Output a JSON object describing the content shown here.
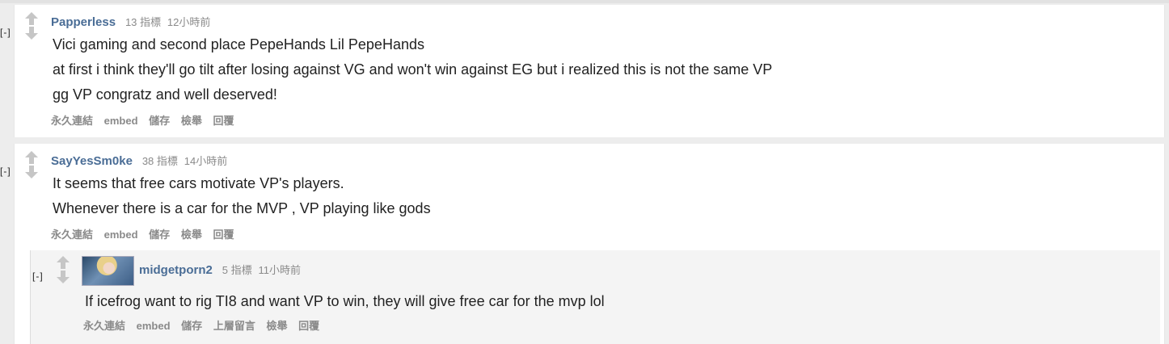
{
  "colors": {
    "author": "#4a6d96",
    "meta": "#8a8a8a",
    "text": "#222222"
  },
  "icons": {
    "upvote": "up-arrow",
    "downvote": "down-arrow"
  },
  "comments": [
    {
      "collapse": "[-]",
      "author": "Papperless",
      "score": "13 指標",
      "time": "12小時前",
      "lines": [
        "Vici gaming and second place PepeHands Lil PepeHands",
        "at first i think they'll go tilt after losing against VG and won't win against EG but i realized this is not the same VP",
        "gg VP congratz and well deserved!"
      ],
      "actions": [
        "永久連結",
        "embed",
        "儲存",
        "檢舉",
        "回覆"
      ]
    },
    {
      "collapse": "[-]",
      "author": "SayYesSm0ke",
      "score": "38 指標",
      "time": "14小時前",
      "lines": [
        "It seems that free cars motivate VP's players.",
        "Whenever there is a car for the MVP , VP playing like gods"
      ],
      "actions": [
        "永久連結",
        "embed",
        "儲存",
        "檢舉",
        "回覆"
      ],
      "reply": {
        "collapse": "[-]",
        "author": "midgetporn2",
        "score": "5 指標",
        "time": "11小時前",
        "lines": [
          "If icefrog want to rig TI8 and want VP to win, they will give free car for the mvp lol"
        ],
        "actions": [
          "永久連結",
          "embed",
          "儲存",
          "上層留言",
          "檢舉",
          "回覆"
        ]
      }
    }
  ]
}
